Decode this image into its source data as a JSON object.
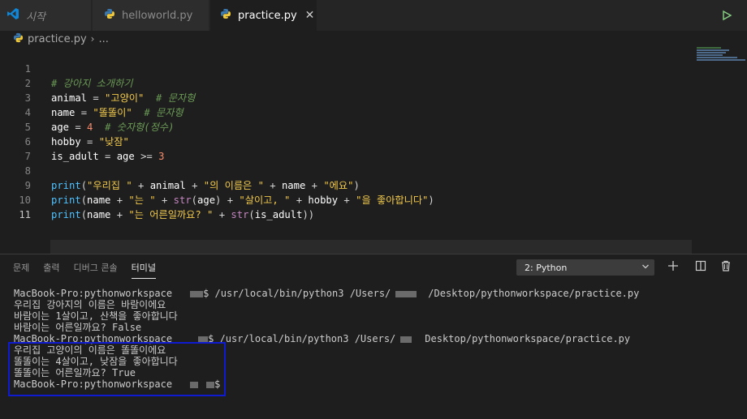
{
  "tabs": [
    {
      "label": "시작"
    },
    {
      "label": "helloworld.py"
    },
    {
      "label": "practice.py"
    }
  ],
  "breadcrumb": {
    "file": "practice.py",
    "rest": "..."
  },
  "editor": {
    "line_numbers": [
      "1",
      "2",
      "3",
      "4",
      "5",
      "6",
      "7",
      "8",
      "9",
      "10",
      "11"
    ],
    "l1": {
      "comment": "# 강아지 소개하기"
    },
    "l2": {
      "var": "animal",
      "eq": " = ",
      "str": "\"고양이\"",
      "comment": "# 문자형"
    },
    "l3": {
      "var": "name",
      "eq": " = ",
      "str": "\"똘똘이\"",
      "comment": "# 문자형"
    },
    "l4": {
      "var": "age",
      "eq": " = ",
      "num": "4",
      "comment": "# 숫자형(정수)"
    },
    "l5": {
      "var": "hobby",
      "eq": " = ",
      "str": "\"낮잠\""
    },
    "l6": {
      "var": "is_adult",
      "eq": " = ",
      "var2": "age",
      "op": " >= ",
      "num": "3"
    },
    "l8": {
      "fn": "print",
      "s1": "\"우리집 \"",
      "v1": "animal",
      "s2": "\"의 이름은 \"",
      "v2": "name",
      "s3": "\"에요\""
    },
    "l9": {
      "fn": "print",
      "v1": "name",
      "s1": "\"는 \"",
      "fn2": "str",
      "v2": "age",
      "s2": "\"살이고, \"",
      "v3": "hobby",
      "s3": "\"을 좋아합니다\""
    },
    "l10": {
      "fn": "print",
      "v1": "name",
      "s1": "\"는 어른일까요? \"",
      "fn2": "str",
      "v2": "is_adult"
    }
  },
  "panel": {
    "tabs": [
      "문제",
      "출력",
      "디버그 콘솔",
      "터미널"
    ],
    "terminal_select": "2: Python",
    "lines": [
      {
        "pre": "MacBook-Pro:pythonworkspace",
        "post": "$ /usr/local/bin/python3 /Users/",
        "post2": "/Desktop/pythonworkspace/practice.py"
      },
      {
        "text": "우리집 강아지의 이름은 바람이에요"
      },
      {
        "text": "바람이는 1살이고, 산책을 좋아합니다"
      },
      {
        "text": "바람이는 어른일까요? False"
      },
      {
        "pre": "MacBook-Pro:pythonworkspace",
        "post": "$ /usr/local/bin/python3 /Users/",
        "post2": "Desktop/pythonworkspace/practice.py"
      },
      {
        "text": "우리집 고양이의 이름은 똘똘이에요"
      },
      {
        "text": "똘똘이는 4살이고, 낮잠을 좋아합니다"
      },
      {
        "text": "똘똘이는 어른일까요? True"
      },
      {
        "pre": "MacBook-Pro:pythonworkspace",
        "post": "$"
      }
    ]
  },
  "colors": {
    "highlight_box": "#0f1bd0",
    "accent": "#0078d4"
  }
}
